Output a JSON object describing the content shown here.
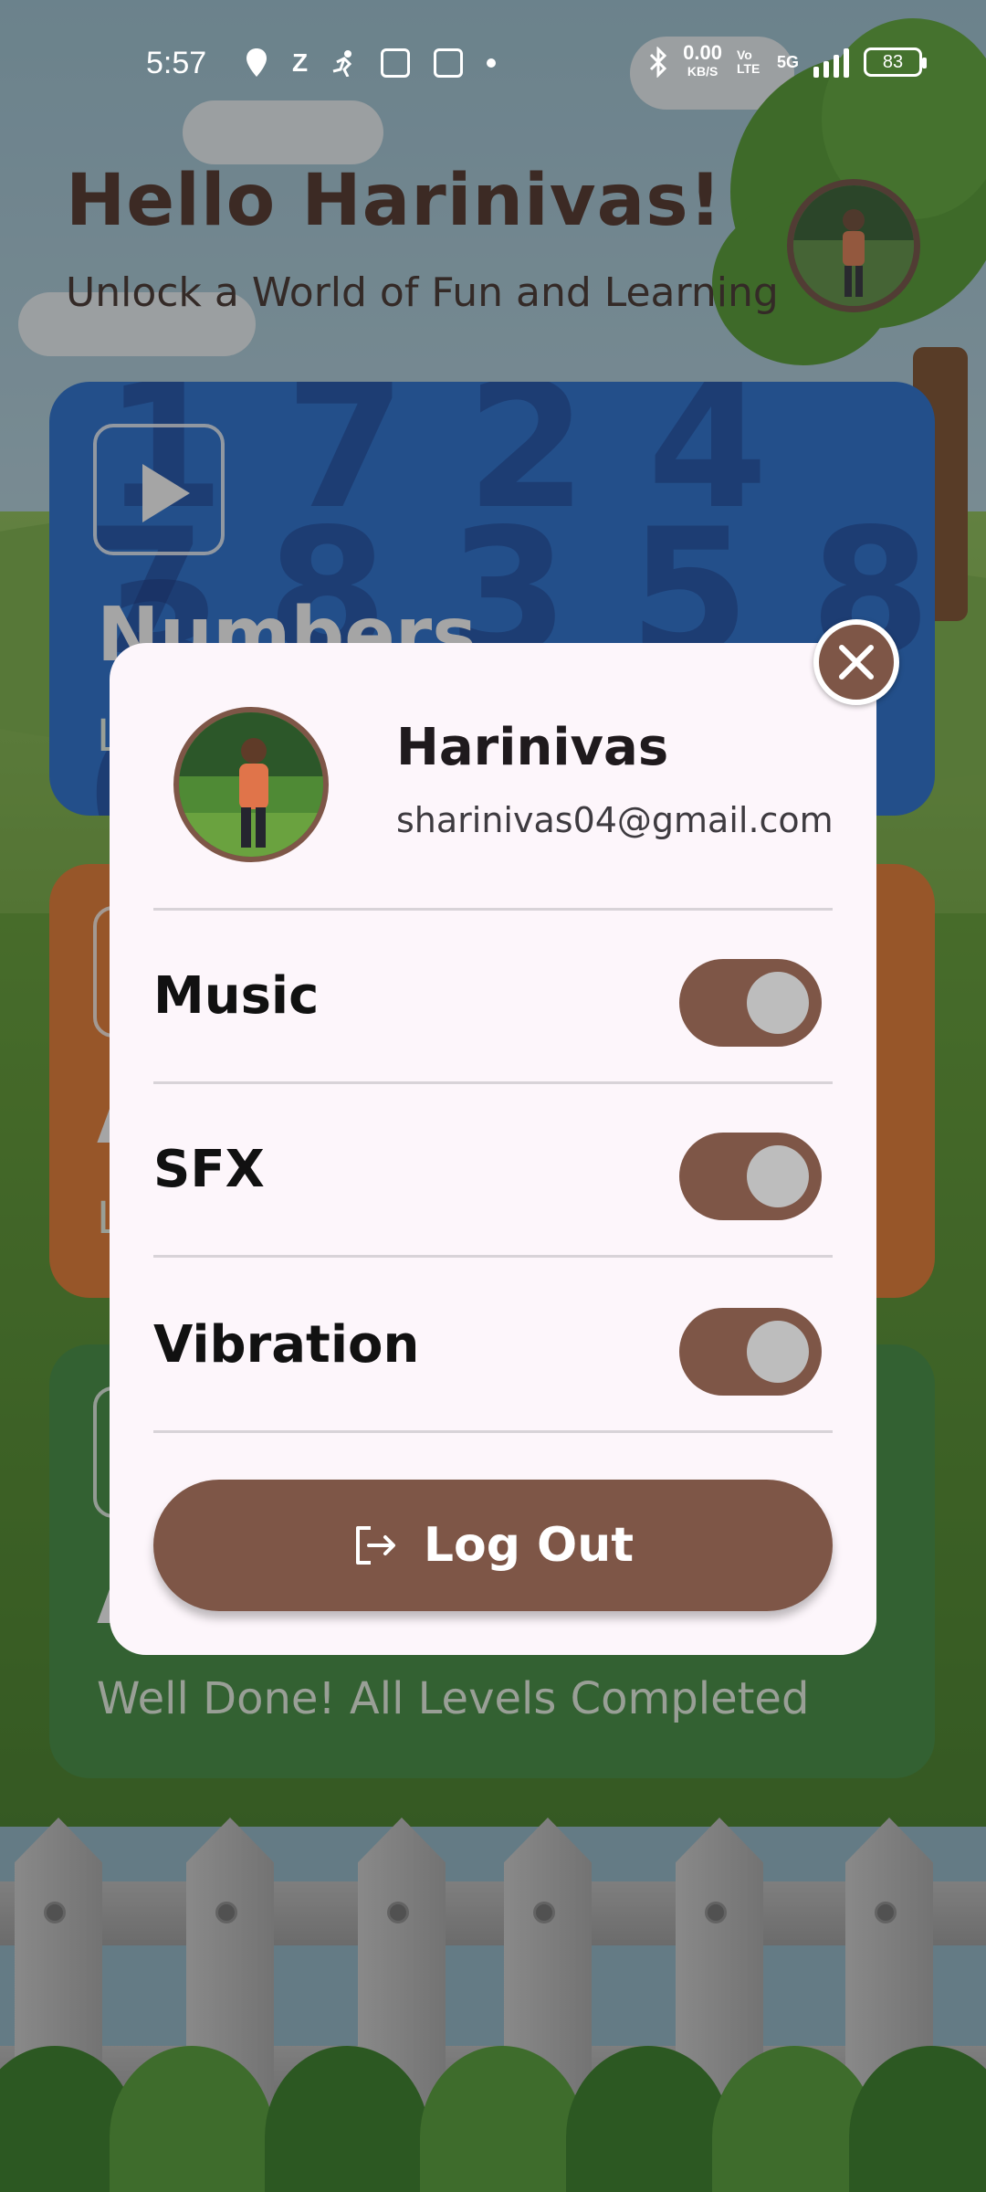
{
  "status_bar": {
    "time": "5:57",
    "left_icons": [
      "location-icon",
      "z-icon",
      "runner-icon",
      "grid-app-icon",
      "grid-app-icon",
      "dot-icon"
    ],
    "network_speed": "0.00",
    "network_unit": "KB/S",
    "volte": "Vo LTE",
    "network_type": "5G",
    "battery": "83"
  },
  "home": {
    "greeting": "Hello Harinivas!",
    "subtitle": "Unlock a World of Fun and Learning",
    "cards": [
      {
        "title": "Numbers",
        "subtitle": "L"
      },
      {
        "title": "A",
        "subtitle": "L"
      },
      {
        "title": "A",
        "subtitle": "Well Done! All Levels Completed"
      }
    ]
  },
  "profile_modal": {
    "name": "Harinivas",
    "email": "sharinivas04@gmail.com",
    "settings": [
      {
        "label": "Music",
        "enabled": true
      },
      {
        "label": "SFX",
        "enabled": true
      },
      {
        "label": "Vibration",
        "enabled": true
      }
    ],
    "logout_label": "Log Out"
  },
  "colors": {
    "accent_brown": "#7e5647",
    "modal_bg": "#fdf6fb",
    "title_brown": "#4b2b22"
  }
}
